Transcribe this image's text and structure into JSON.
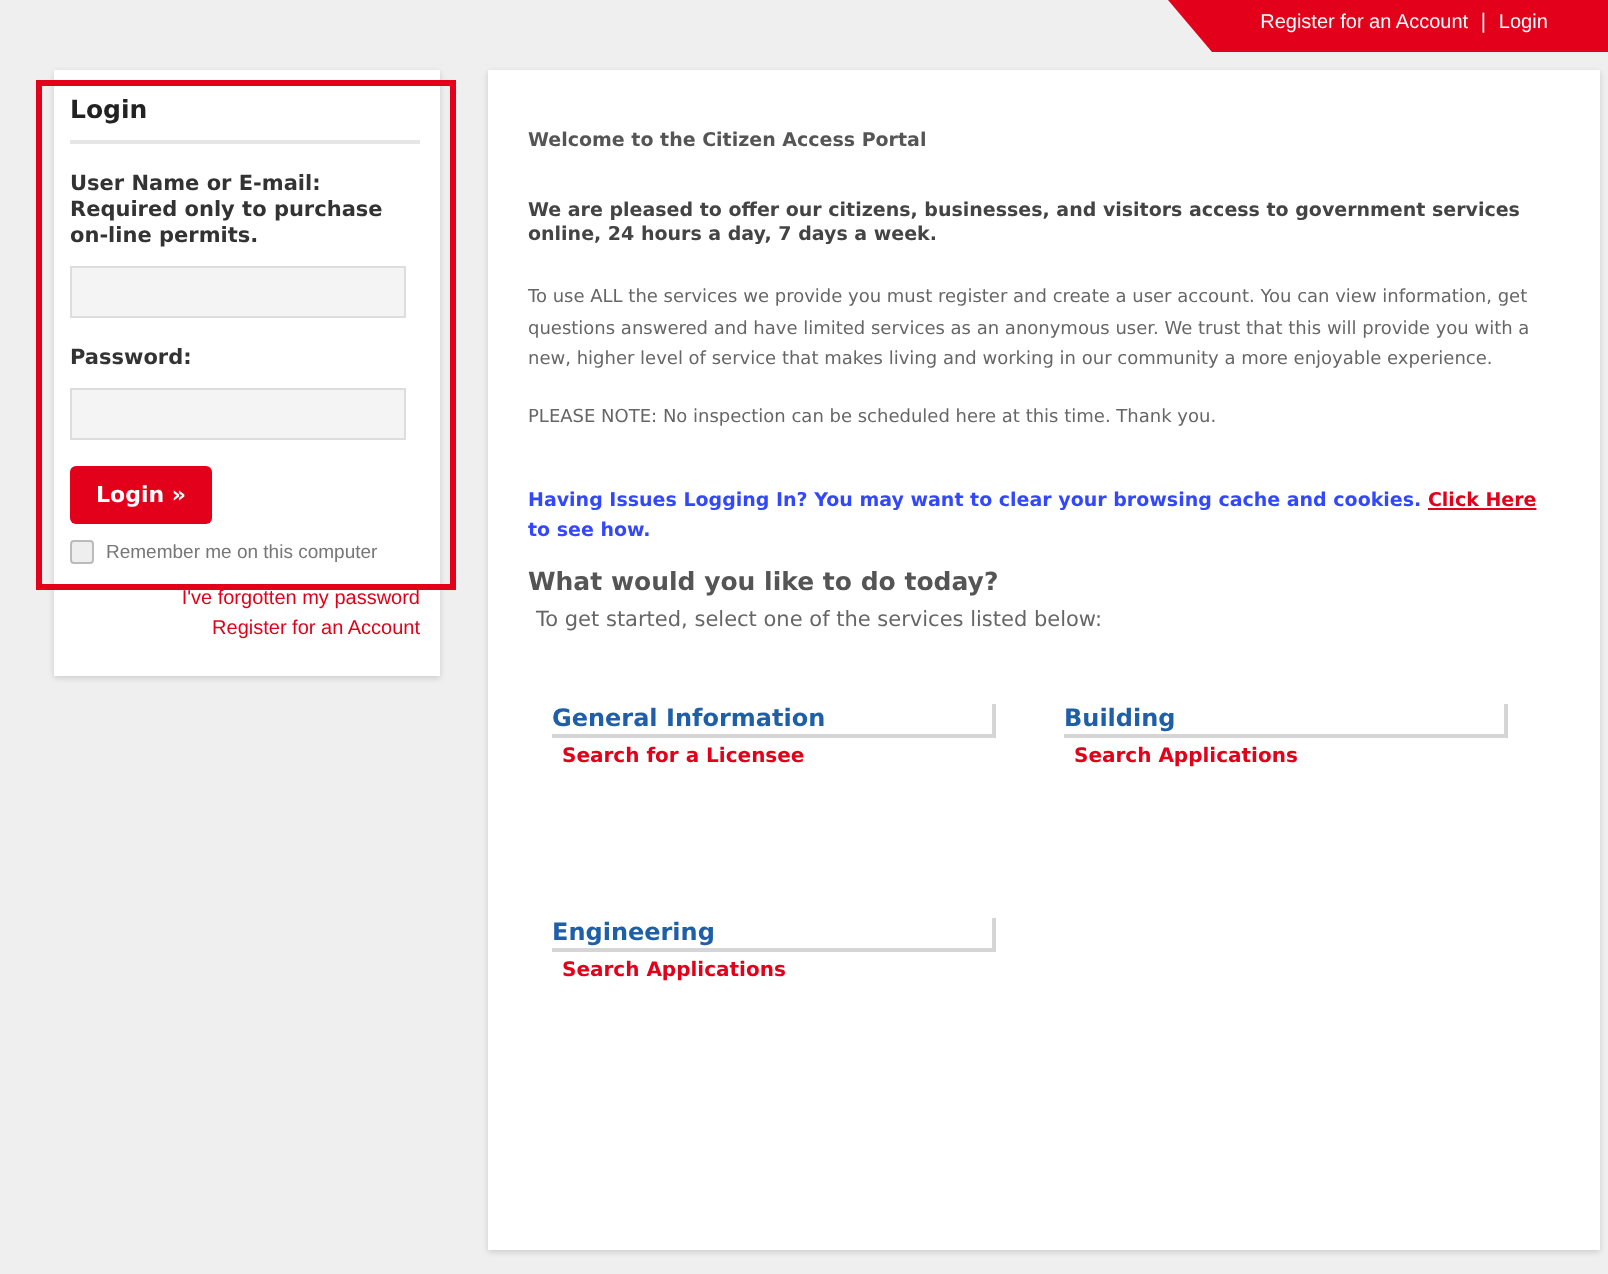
{
  "top_bar": {
    "links": [
      "Register for an Account",
      "Login"
    ],
    "separator": "|"
  },
  "login": {
    "title": "Login",
    "username_label": "User Name or E-mail: Required only to purchase on-line permits.",
    "password_label": "Password:",
    "button": "Login »",
    "remember": {
      "label": "Remember me on this computer",
      "checked": false
    },
    "links": [
      "I've forgotten my password",
      "Register for an Account"
    ]
  },
  "main": {
    "welcome": "Welcome to the Citizen Access Portal",
    "intro": "We are pleased to offer our citizens, businesses, and visitors access to government services online, 24 hours a day, 7 days a week.",
    "body": "To use ALL the services we provide you must register and create a user account. You can view information, get questions answered and have limited services as an anonymous user. We trust that this will provide you with a new, higher level of service that makes living and working in our community a more enjoyable experience.",
    "note": "PLEASE NOTE: No inspection can be scheduled here at this time. Thank you.",
    "issues": {
      "text": "Having Issues Logging In? You may want to clear your browsing cache and cookies.",
      "link": "Click Here",
      "after": "to see how."
    },
    "question": "What would you like to do today?",
    "subtitle": "To get started, select one of the services listed below:",
    "services": [
      {
        "title": "General Information",
        "links": [
          "Search for a Licensee"
        ]
      },
      {
        "title": "Building",
        "links": [
          "Search Applications"
        ]
      },
      {
        "title": "Engineering",
        "links": [
          "Search Applications"
        ]
      }
    ]
  }
}
